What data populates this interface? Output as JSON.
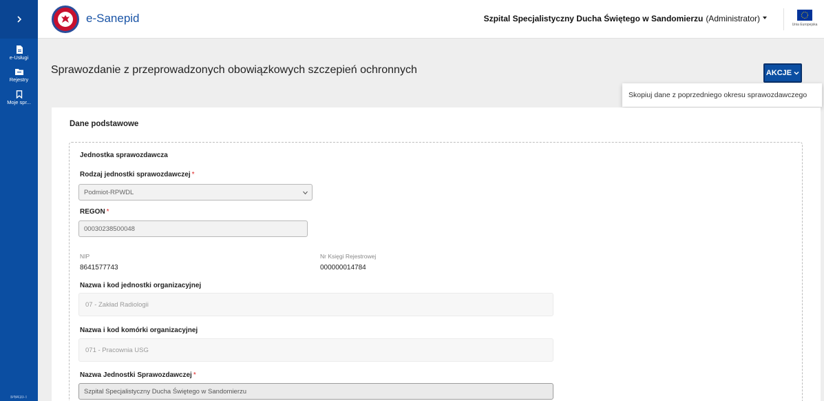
{
  "sidebar": {
    "toggle_icon": "chevron-right-icon",
    "items": [
      {
        "label": "e-Usługi",
        "icon": "document-icon"
      },
      {
        "label": "Rejestry",
        "icon": "folder-icon"
      },
      {
        "label": "Moje spr...",
        "icon": "bookmark-icon"
      }
    ],
    "footer": "IP8410-T"
  },
  "header": {
    "brand": "e-Sanepid",
    "organization": "Szpital Specjalistyczny Ducha Świętego w Sandomierzu",
    "role": "(Administrator)",
    "eu_label": "Unia Europejska"
  },
  "page": {
    "title": "Sprawozdanie z przeprowadzonych obowiązkowych szczepień ochronnych",
    "actions_label": "AKCJE",
    "actions_menu": [
      "Skopiuj dane z poprzedniego okresu sprawozdawczego"
    ]
  },
  "form": {
    "section_title": "Dane podstawowe",
    "fieldset_title": "Jednostka sprawozdawcza",
    "required_mark": "*",
    "unit_type": {
      "label": "Rodzaj jednostki sprawozdawczej",
      "value": "Podmiot-RPWDL"
    },
    "regon": {
      "label": "REGON",
      "value": "00030238500048"
    },
    "nip": {
      "label": "NIP",
      "value": "8641577743"
    },
    "registry_book": {
      "label": "Nr Księgi Rejestrowej",
      "value": "000000014784"
    },
    "org_unit": {
      "label": "Nazwa i kod jednostki organizacyjnej",
      "value": "07 - Zakład Radiologii"
    },
    "org_cell": {
      "label": "Nazwa i kod komórki organizacyjnej",
      "value": "071 - Pracownia USG"
    },
    "reporting_unit_name": {
      "label": "Nazwa Jednostki Sprawozdawczej",
      "value": "Szpital Specjalistyczny Ducha Świętego w Sandomierzu"
    }
  }
}
